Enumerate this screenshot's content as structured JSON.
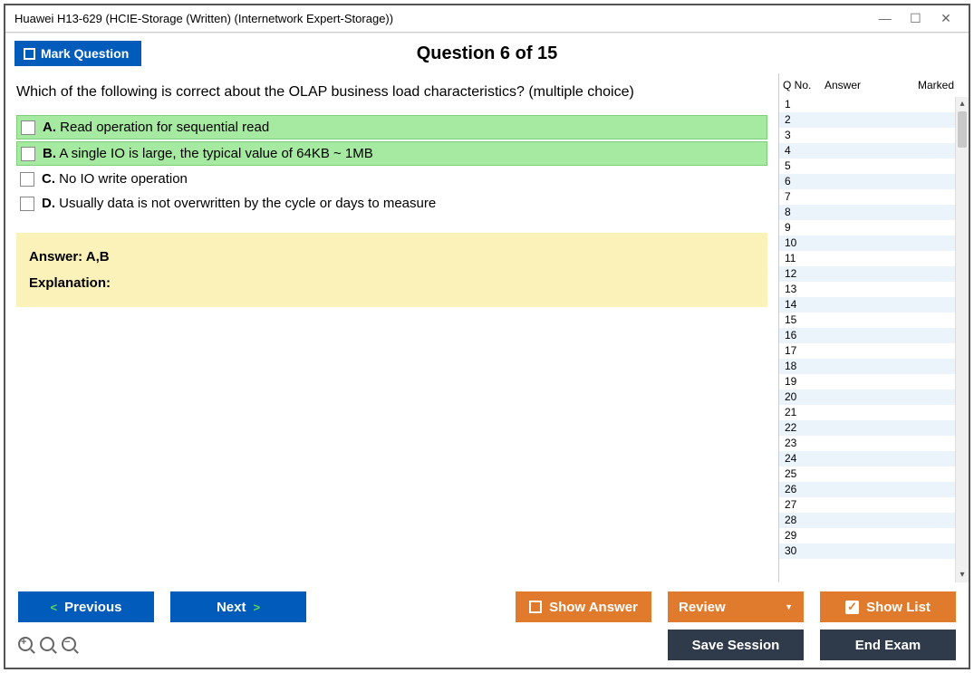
{
  "window": {
    "title": "Huawei H13-629 (HCIE-Storage (Written) (Internetwork Expert-Storage))"
  },
  "topbar": {
    "mark_label": "Mark Question",
    "question_counter": "Question 6 of 15"
  },
  "main": {
    "prompt": "Which of the following is correct about the OLAP business load characteristics? (multiple choice)",
    "options": [
      {
        "key": "A.",
        "text": "Read operation for sequential read",
        "highlighted": true
      },
      {
        "key": "B.",
        "text": "A single IO is large, the typical value of 64KB ~ 1MB",
        "highlighted": true
      },
      {
        "key": "C.",
        "text": "No IO write operation",
        "highlighted": false
      },
      {
        "key": "D.",
        "text": "Usually data is not overwritten by the cycle or days to measure",
        "highlighted": false
      }
    ],
    "answer_line": "Answer: A,B",
    "explanation_label": "Explanation:"
  },
  "side": {
    "headers": {
      "qno": "Q No.",
      "answer": "Answer",
      "marked": "Marked"
    },
    "rows": [
      "1",
      "2",
      "3",
      "4",
      "5",
      "6",
      "7",
      "8",
      "9",
      "10",
      "11",
      "12",
      "13",
      "14",
      "15",
      "16",
      "17",
      "18",
      "19",
      "20",
      "21",
      "22",
      "23",
      "24",
      "25",
      "26",
      "27",
      "28",
      "29",
      "30"
    ]
  },
  "bottom": {
    "previous": "Previous",
    "next": "Next",
    "show_answer": "Show Answer",
    "review": "Review",
    "show_list": "Show List",
    "save_session": "Save Session",
    "end_exam": "End Exam"
  }
}
